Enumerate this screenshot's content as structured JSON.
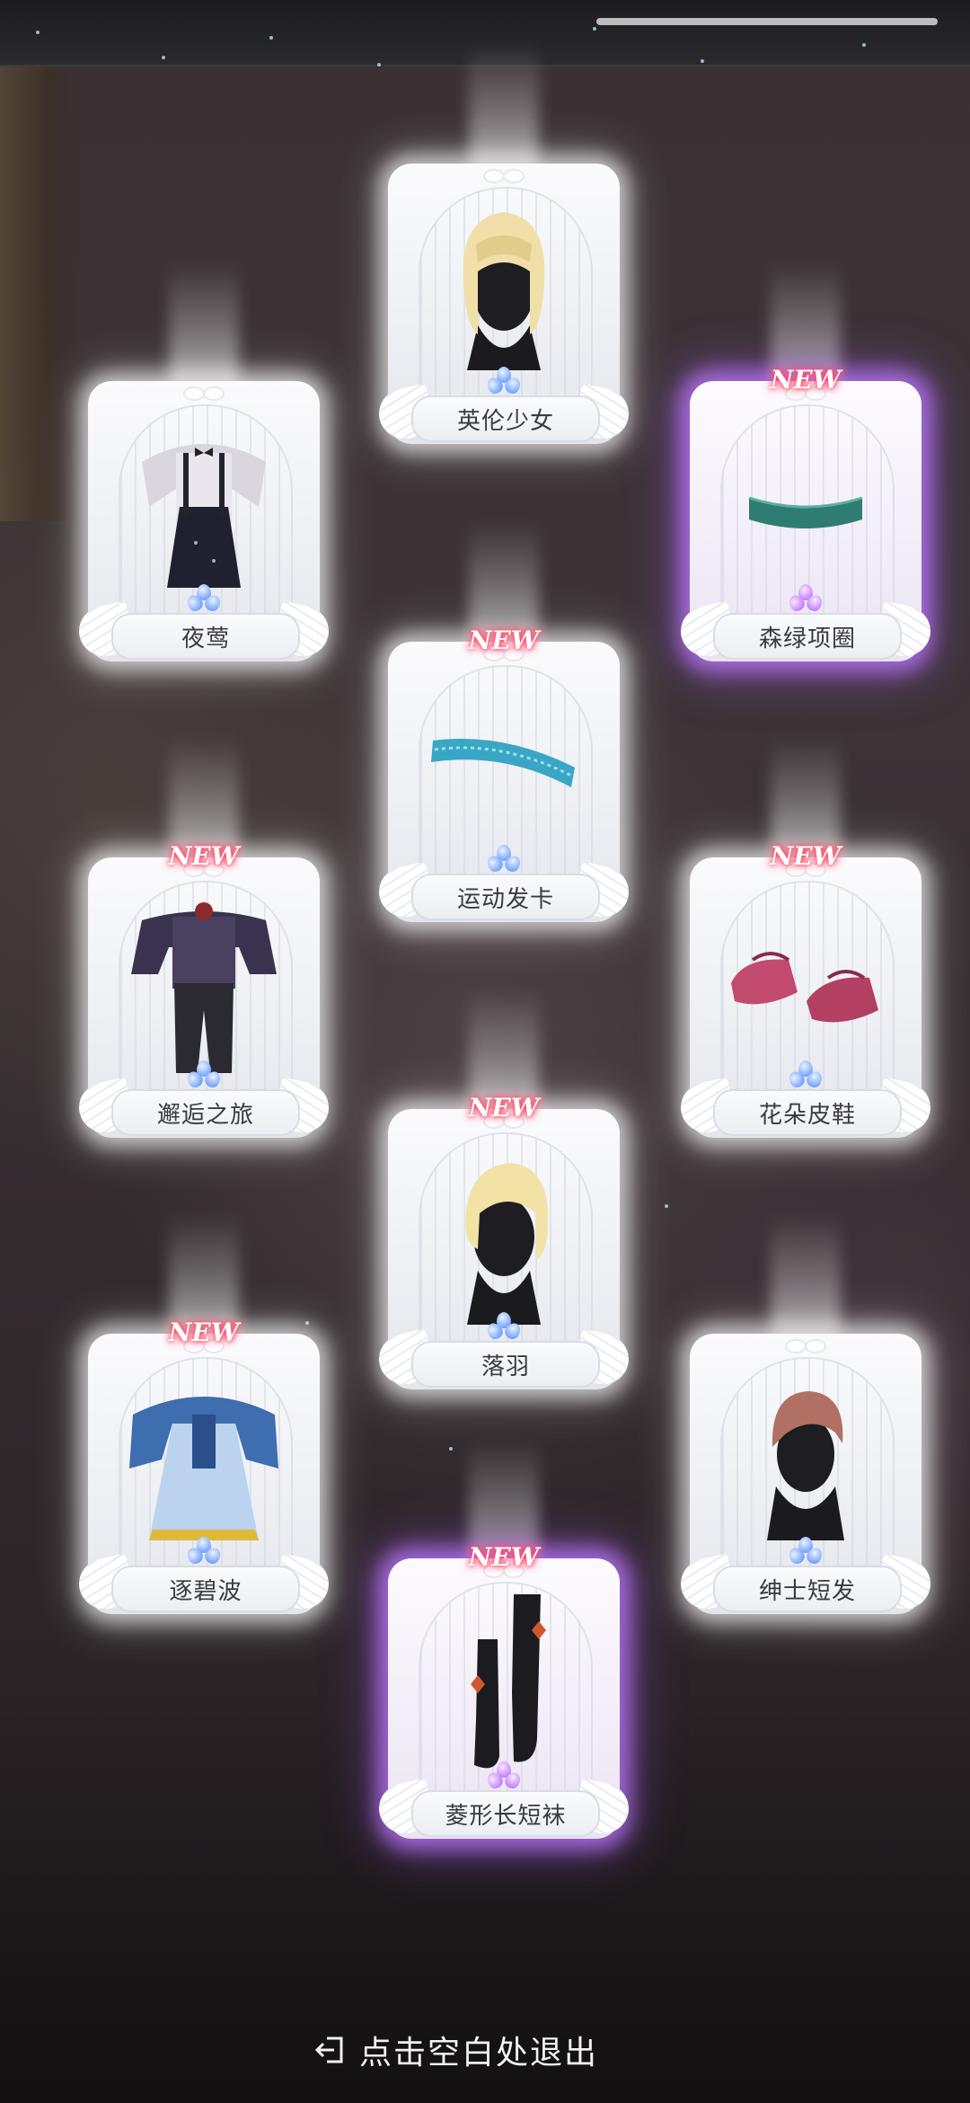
{
  "app": {
    "exit_hint": "点击空白处退出"
  },
  "cards": [
    {
      "name": "英伦少女",
      "new": false,
      "rarity": "normal",
      "item_icon": "blonde-bob-hair-icon"
    },
    {
      "name": "夜莺",
      "new": false,
      "rarity": "normal",
      "item_icon": "suspender-outfit-icon"
    },
    {
      "name": "森绿项圈",
      "new": true,
      "new_label": "NEW",
      "rarity": "purple",
      "item_icon": "green-choker-icon"
    },
    {
      "name": "运动发卡",
      "new": true,
      "new_label": "NEW",
      "rarity": "normal",
      "item_icon": "headband-icon"
    },
    {
      "name": "邂逅之旅",
      "new": true,
      "new_label": "NEW",
      "rarity": "normal",
      "item_icon": "striped-suit-icon"
    },
    {
      "name": "花朵皮鞋",
      "new": true,
      "new_label": "NEW",
      "rarity": "normal",
      "item_icon": "pink-shoes-icon"
    },
    {
      "name": "落羽",
      "new": true,
      "new_label": "NEW",
      "rarity": "normal",
      "item_icon": "short-blonde-hair-icon"
    },
    {
      "name": "逐碧波",
      "new": true,
      "new_label": "NEW",
      "rarity": "normal",
      "item_icon": "blue-hanfu-icon"
    },
    {
      "name": "绅士短发",
      "new": false,
      "rarity": "normal",
      "item_icon": "brown-short-hair-icon"
    },
    {
      "name": "菱形长短袜",
      "new": true,
      "new_label": "NEW",
      "rarity": "purple",
      "item_icon": "diamond-socks-icon"
    }
  ]
}
